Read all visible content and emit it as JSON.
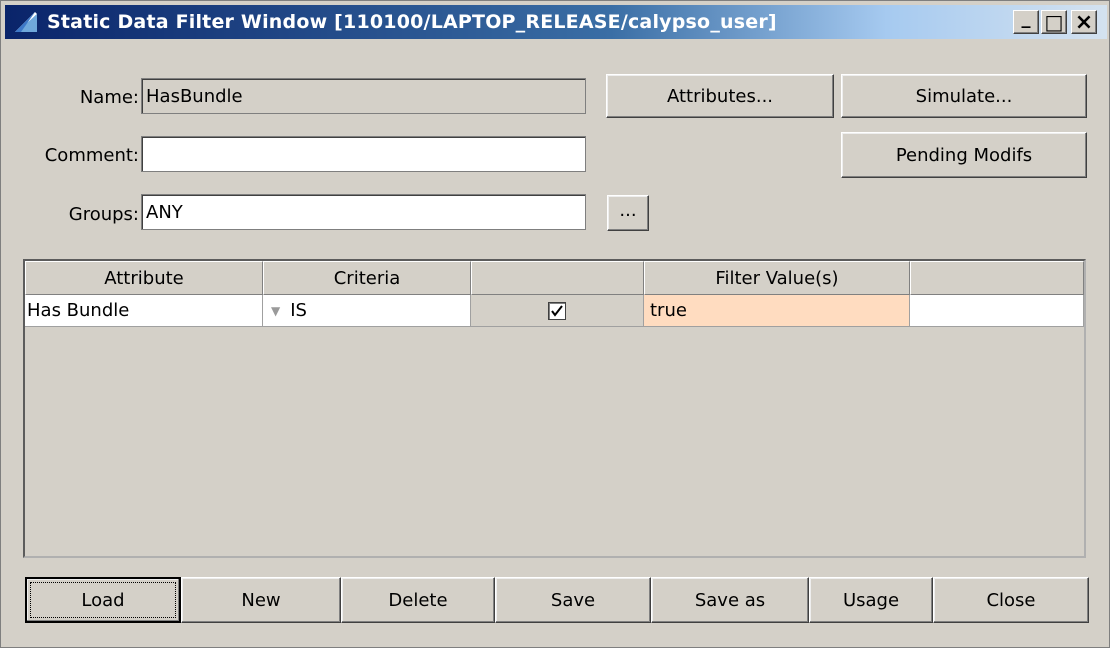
{
  "window": {
    "title": "Static Data Filter Window  [110100/LAPTOP_RELEASE/calypso_user]",
    "minimize": "_",
    "maximize": "□",
    "close": "×"
  },
  "form": {
    "name_label": "Name:",
    "name_value": "HasBundle",
    "comment_label": "Comment:",
    "comment_value": "",
    "groups_label": "Groups:",
    "groups_value": "ANY",
    "groups_browse": "..."
  },
  "side_buttons": {
    "attributes": "Attributes...",
    "simulate": "Simulate...",
    "pending": "Pending Modifs"
  },
  "table": {
    "headers": [
      "Attribute",
      "Criteria",
      "",
      "Filter Value(s)",
      ""
    ],
    "rows": [
      {
        "attribute": "Has Bundle",
        "criteria": "IS",
        "checked": true,
        "filter_value": "true",
        "extra": ""
      }
    ]
  },
  "bottom_buttons": {
    "load": "Load",
    "new": "New",
    "delete": "Delete",
    "save": "Save",
    "save_as": "Save as",
    "usage": "Usage",
    "close": "Close"
  },
  "colors": {
    "filter_value_cell": "#ffdcc0",
    "title_gradient_start": "#0a246a"
  }
}
